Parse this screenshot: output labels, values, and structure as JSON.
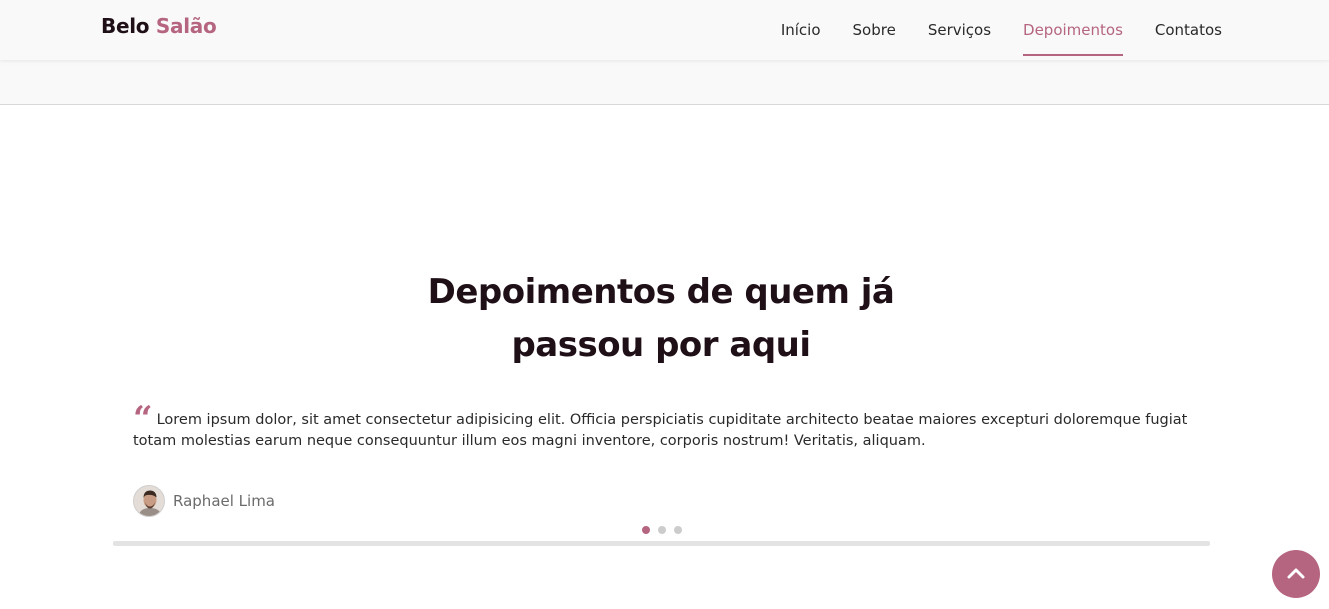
{
  "header": {
    "logo_main": "Belo",
    "logo_accent": "Salão",
    "nav": [
      {
        "label": "Início"
      },
      {
        "label": "Sobre"
      },
      {
        "label": "Serviços"
      },
      {
        "label": "Depoimentos",
        "active": true
      },
      {
        "label": "Contatos"
      }
    ]
  },
  "section": {
    "title_line1": "Depoimentos de quem já",
    "title_line2": "passou por aqui"
  },
  "testimonial": {
    "quote_glyph": "“",
    "text": "Lorem ipsum dolor, sit amet consectetur adipisicing elit. Officia perspiciatis cupiditate architecto beatae maiores excepturi doloremque fugiat totam molestias earum neque consequuntur illum eos magni inventore, corporis nostrum! Veritatis, aliquam.",
    "author": "Raphael Lima",
    "avatar_icon": "person-avatar"
  },
  "carousel": {
    "slides": 3,
    "active_index": 0
  },
  "back_to_top_icon": "chevron-up-icon",
  "colors": {
    "accent": "#b5657f",
    "dark": "#1f0f17",
    "header_bg": "#f9f9f9",
    "dot_inactive": "#cccccc"
  }
}
